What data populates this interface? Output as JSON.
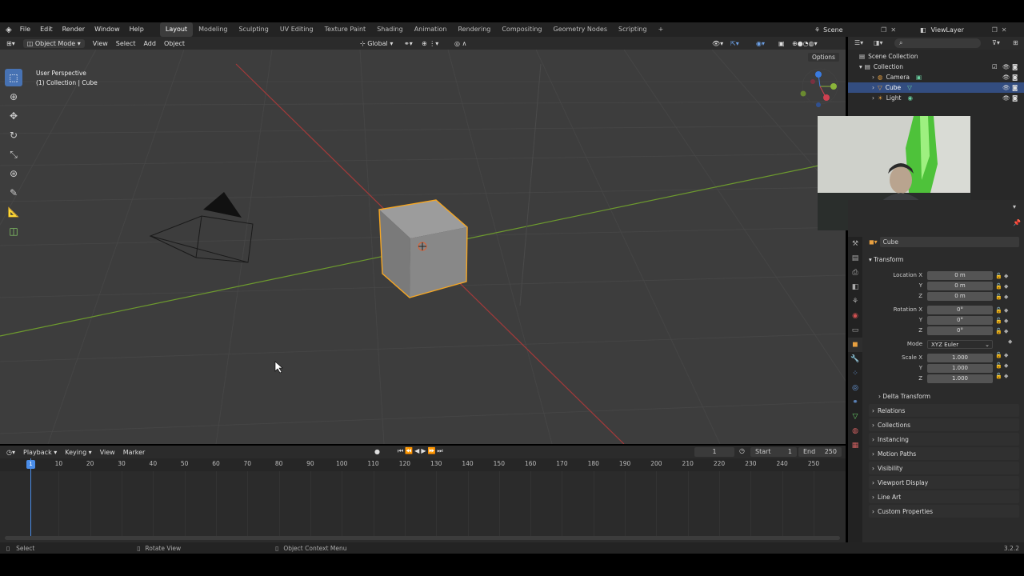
{
  "topbar": {
    "menus": [
      "File",
      "Edit",
      "Render",
      "Window",
      "Help"
    ],
    "workspaces": [
      "Layout",
      "Modeling",
      "Sculpting",
      "UV Editing",
      "Texture Paint",
      "Shading",
      "Animation",
      "Rendering",
      "Compositing",
      "Geometry Nodes",
      "Scripting"
    ],
    "add_tab": "+",
    "scene": "Scene",
    "view_layer": "ViewLayer"
  },
  "viewport_header": {
    "mode": "Object Mode",
    "view": "View",
    "select": "Select",
    "add": "Add",
    "object": "Object",
    "orientation": "Global",
    "options": "Options"
  },
  "viewport": {
    "perspective": "User Perspective",
    "context": "(1) Collection | Cube"
  },
  "timeline": {
    "playback": "Playback",
    "keying": "Keying",
    "view": "View",
    "marker": "Marker",
    "current_frame": "1",
    "start_label": "Start",
    "start": "1",
    "end_label": "End",
    "end": "250",
    "ticks": [
      "1",
      "10",
      "20",
      "30",
      "40",
      "50",
      "60",
      "70",
      "80",
      "90",
      "100",
      "110",
      "120",
      "130",
      "140",
      "150",
      "160",
      "170",
      "180",
      "190",
      "200",
      "210",
      "220",
      "230",
      "240",
      "250"
    ]
  },
  "outliner": {
    "root": "Scene Collection",
    "collection": "Collection",
    "items": [
      "Camera",
      "Cube",
      "Light"
    ]
  },
  "properties": {
    "object_name": "Cube",
    "transform": "Transform",
    "location_label": "Location X",
    "rotation_label": "Rotation X",
    "scale_label": "Scale X",
    "y": "Y",
    "z": "Z",
    "location": [
      "0 m",
      "0 m",
      "0 m"
    ],
    "rotation": [
      "0°",
      "0°",
      "0°"
    ],
    "scale": [
      "1.000",
      "1.000",
      "1.000"
    ],
    "mode_label": "Mode",
    "mode": "XYZ Euler",
    "delta": "Delta Transform",
    "panels": [
      "Relations",
      "Collections",
      "Instancing",
      "Motion Paths",
      "Visibility",
      "Viewport Display",
      "Line Art",
      "Custom Properties"
    ]
  },
  "statusbar": {
    "select": "Select",
    "rotate": "Rotate View",
    "context_menu": "Object Context Menu",
    "version": "3.2.2"
  },
  "colors": {
    "selection": "#4772b3",
    "outline": "#f5a623",
    "x_axis": "#b03030",
    "y_axis": "#6a9a2a"
  }
}
